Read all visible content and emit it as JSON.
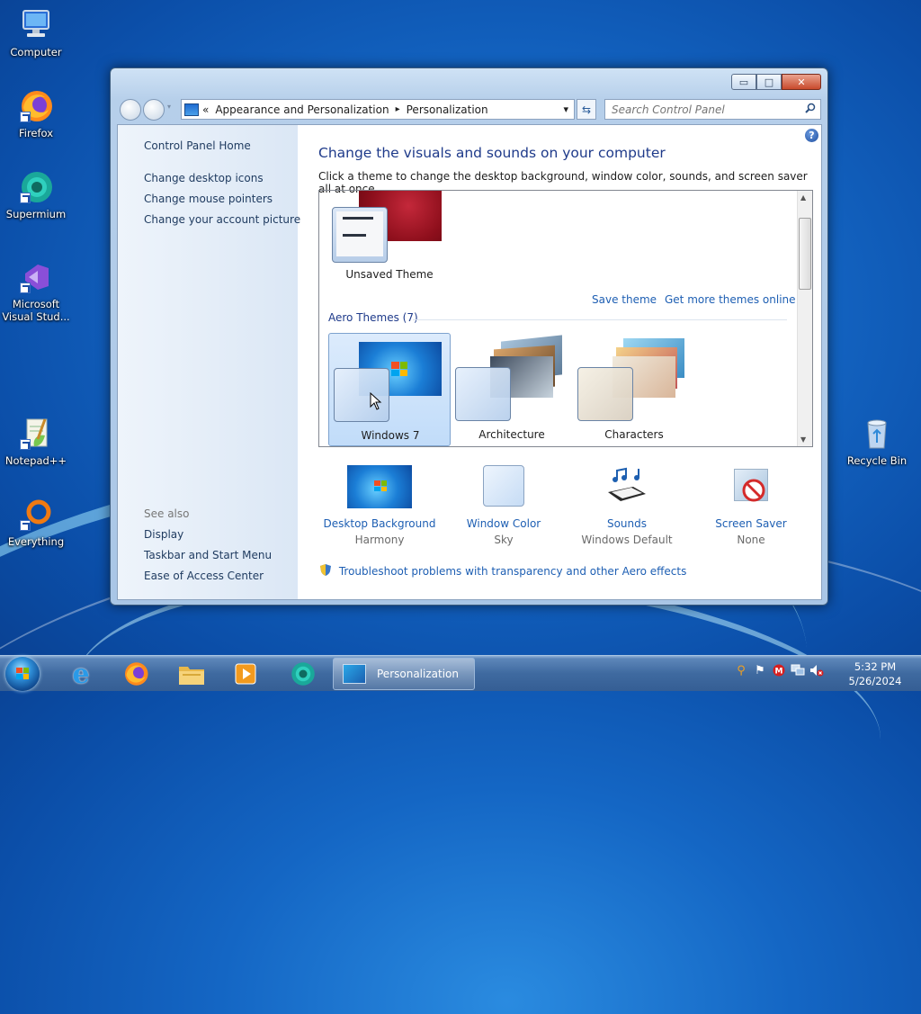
{
  "desktop": {
    "icons": [
      {
        "label": "Computer"
      },
      {
        "label": "Firefox"
      },
      {
        "label": "Supermium"
      },
      {
        "label": "Microsoft Visual Stud..."
      },
      {
        "label": "Notepad++"
      },
      {
        "label": "Everything"
      },
      {
        "label": "Recycle Bin"
      }
    ]
  },
  "window": {
    "controls": {
      "minimize": "▭",
      "maximize": "□",
      "close": "✕"
    },
    "address": {
      "prefix": "«",
      "crumb1": "Appearance and Personalization",
      "separator": "▸",
      "crumb2": "Personalization",
      "dropdown": "▾"
    },
    "refresh_glyph": "⇆",
    "search": {
      "placeholder": "Search Control Panel",
      "icon": "search-icon"
    },
    "left_pane": {
      "home": "Control Panel Home",
      "links": [
        "Change desktop icons",
        "Change mouse pointers",
        "Change your account picture"
      ],
      "see_also_heading": "See also",
      "see_also": [
        "Display",
        "Taskbar and Start Menu",
        "Ease of Access Center"
      ]
    },
    "main": {
      "help": "?",
      "title": "Change the visuals and sounds on your computer",
      "subtitle": "Click a theme to change the desktop background, window color, sounds, and screen saver all at once.",
      "unsaved_theme": "Unsaved Theme",
      "save_theme": "Save theme",
      "get_more": "Get more themes online",
      "aero_heading": "Aero Themes (7)",
      "themes": [
        {
          "label": "Windows 7",
          "selected": true
        },
        {
          "label": "Architecture",
          "selected": false
        },
        {
          "label": "Characters",
          "selected": false
        }
      ],
      "bottom": [
        {
          "label": "Desktop Background",
          "sub": "Harmony"
        },
        {
          "label": "Window Color",
          "sub": "Sky"
        },
        {
          "label": "Sounds",
          "sub": "Windows Default"
        },
        {
          "label": "Screen Saver",
          "sub": "None"
        }
      ],
      "troubleshoot": "Troubleshoot problems with transparency and other Aero effects"
    }
  },
  "taskbar": {
    "active_task": "Personalization",
    "clock_time": "5:32 PM",
    "clock_date": "5/26/2024"
  },
  "colors": {
    "link": "#1e5fb3",
    "title": "#1e3a8a",
    "desktop": "#1466c4",
    "taskbar": "#3f6aa0"
  }
}
